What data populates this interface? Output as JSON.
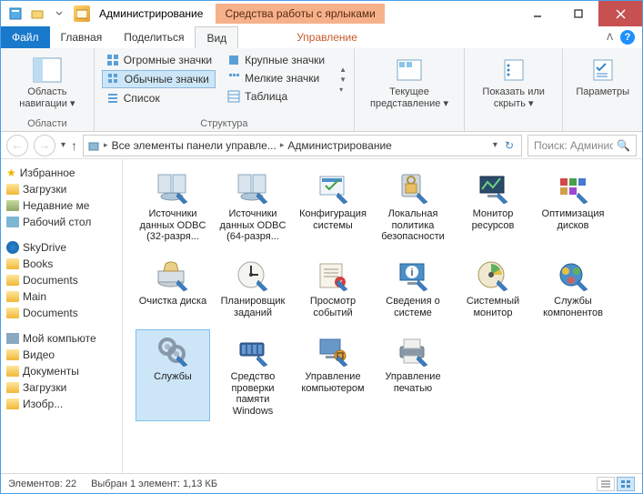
{
  "titlebar": {
    "title": "Администрирование",
    "context_tab": "Средства работы с ярлыками"
  },
  "tabs": {
    "file": "Файл",
    "home": "Главная",
    "share": "Поделиться",
    "view": "Вид",
    "manage": "Управление"
  },
  "ribbon": {
    "nav_pane": {
      "label": "Область навигации ▾",
      "group": "Области"
    },
    "layout": {
      "huge": "Огромные значки",
      "large": "Крупные значки",
      "normal": "Обычные значки",
      "small": "Мелкие значки",
      "list": "Список",
      "table": "Таблица",
      "group": "Структура"
    },
    "current_view": {
      "label": "Текущее представление ▾"
    },
    "show_hide": {
      "label": "Показать или скрыть ▾"
    },
    "options": {
      "label": "Параметры"
    }
  },
  "breadcrumb": {
    "seg1": "Все элементы панели управле...",
    "seg2": "Администрирование"
  },
  "search": {
    "placeholder": "Поиск: Админис..."
  },
  "sidebar": {
    "favorites": {
      "header": "Избранное",
      "items": [
        "Загрузки",
        "Недавние ме",
        "Рабочий стол"
      ]
    },
    "skydrive": {
      "header": "SkyDrive",
      "items": [
        "Books",
        "Documents",
        "Main",
        "Documents"
      ]
    },
    "computer": {
      "header": "Мой компьюте",
      "items": [
        "Видео",
        "Документы",
        "Загрузки",
        "Изобр..."
      ]
    }
  },
  "items": [
    {
      "label": "Источники данных ODBC (32-разря...",
      "icon": "odbc"
    },
    {
      "label": "Источники данных ODBC (64-разря...",
      "icon": "odbc"
    },
    {
      "label": "Конфигурация системы",
      "icon": "config"
    },
    {
      "label": "Локальная политика безопасности",
      "icon": "security"
    },
    {
      "label": "Монитор ресурсов",
      "icon": "monitor"
    },
    {
      "label": "Оптимизация дисков",
      "icon": "defrag"
    },
    {
      "label": "Очистка диска",
      "icon": "cleanup"
    },
    {
      "label": "Планировщик заданий",
      "icon": "scheduler"
    },
    {
      "label": "Просмотр событий",
      "icon": "events"
    },
    {
      "label": "Сведения о системе",
      "icon": "sysinfo"
    },
    {
      "label": "Системный монитор",
      "icon": "perfmon"
    },
    {
      "label": "Службы компонентов",
      "icon": "compsvc"
    },
    {
      "label": "Службы",
      "icon": "services",
      "selected": true
    },
    {
      "label": "Средство проверки памяти Windows",
      "icon": "memtest"
    },
    {
      "label": "Управление компьютером",
      "icon": "compmgmt"
    },
    {
      "label": "Управление печатью",
      "icon": "print"
    }
  ],
  "status": {
    "count": "Элементов: 22",
    "selected": "Выбран 1 элемент: 1,13 КБ"
  }
}
